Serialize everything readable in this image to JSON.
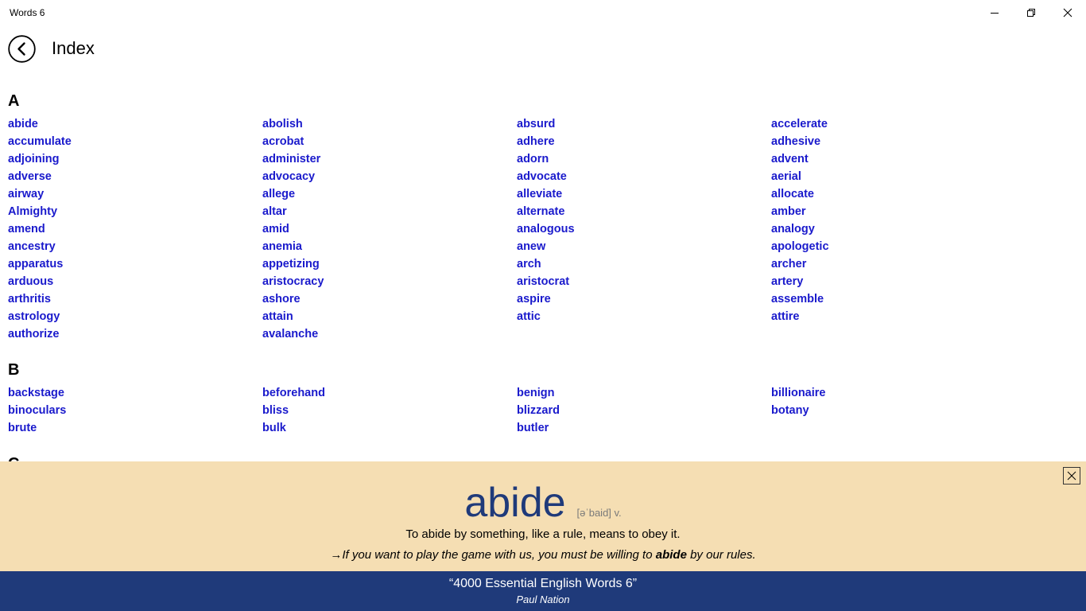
{
  "window": {
    "title": "Words 6",
    "minimize_icon": "minimize-icon",
    "restore_icon": "restore-icon",
    "close_icon": "close-icon"
  },
  "header": {
    "back_icon": "back-arrow-icon",
    "title": "Index"
  },
  "index": {
    "sections": [
      {
        "letter": "A",
        "words": [
          "abide",
          "abolish",
          "absurd",
          "accelerate",
          "accumulate",
          "acrobat",
          "adhere",
          "adhesive",
          "adjoining",
          "administer",
          "adorn",
          "advent",
          "adverse",
          "advocacy",
          "advocate",
          "aerial",
          "airway",
          "allege",
          "alleviate",
          "allocate",
          "Almighty",
          "altar",
          "alternate",
          "amber",
          "amend",
          "amid",
          "analogous",
          "analogy",
          "ancestry",
          "anemia",
          "anew",
          "apologetic",
          "apparatus",
          "appetizing",
          "arch",
          "archer",
          "arduous",
          "aristocracy",
          "aristocrat",
          "artery",
          "arthritis",
          "ashore",
          "aspire",
          "assemble",
          "astrology",
          "attain",
          "attic",
          "attire",
          "authorize",
          "avalanche"
        ]
      },
      {
        "letter": "B",
        "words": [
          "backstage",
          "beforehand",
          "benign",
          "billionaire",
          "binoculars",
          "bliss",
          "blizzard",
          "botany",
          "brute",
          "bulk",
          "butler"
        ]
      },
      {
        "letter": "C",
        "words": []
      }
    ]
  },
  "detail": {
    "word": "abide",
    "pronunciation": "[əˈbaid] v.",
    "definition": "To abide by something, like a rule, means to obey it.",
    "example_arrow": "→",
    "example_before": "If you want to play the game with us, you must be willing to ",
    "example_word": "abide",
    "example_after": " by our rules.",
    "close_icon": "close-icon",
    "background_color": "#f5deb3",
    "word_color": "#1f3a7a"
  },
  "footer": {
    "book_title": "“4000 Essential English Words 6”",
    "author": "Paul Nation",
    "background_color": "#1f3a7a"
  },
  "colors": {
    "link": "#1a1acc"
  }
}
